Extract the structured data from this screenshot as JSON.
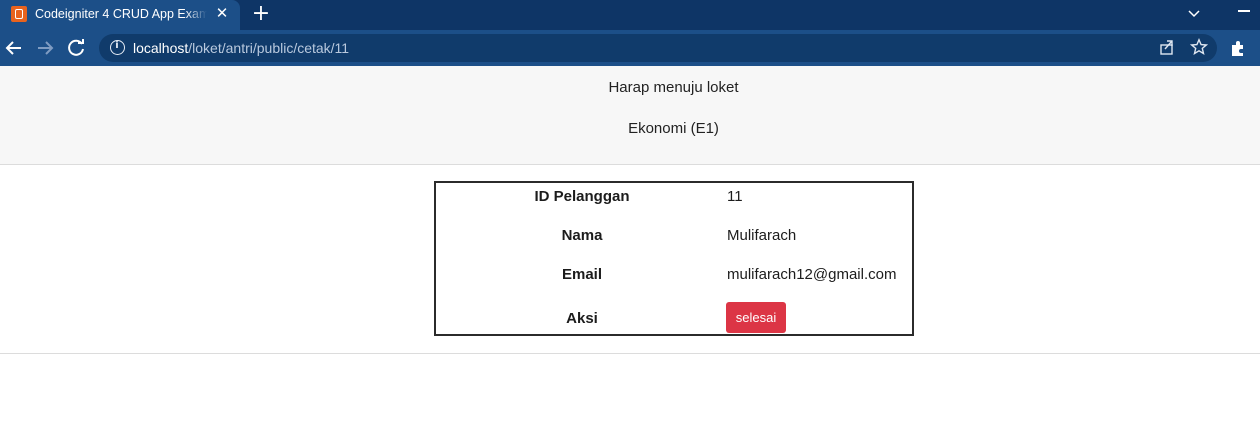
{
  "browser": {
    "tab_title": "Codeigniter 4 CRUD App Example",
    "tab_close": "✕",
    "new_tab": "+",
    "url_host": "localhost",
    "url_path": "/loket/antri/public/cetak/11",
    "icons": [
      "back-icon",
      "forward-icon",
      "reload-icon",
      "info-icon",
      "share-icon",
      "star-icon",
      "extensions-icon",
      "chevron-down-icon",
      "minimize-icon"
    ]
  },
  "header": {
    "line1": "Harap menuju loket",
    "line2": "Ekonomi (E1)"
  },
  "details": {
    "rows": [
      {
        "label": "ID Pelanggan",
        "value": "11"
      },
      {
        "label": "Nama",
        "value": "Mulifarach"
      },
      {
        "label": "Email",
        "value": "mulifarach12@gmail.com"
      },
      {
        "label": "Aksi",
        "value": ""
      }
    ],
    "action_button": "selesai"
  },
  "colors": {
    "tabbar": "#0e3566",
    "toolbar": "#1c4f88",
    "button_danger": "#dc3545",
    "header_bg": "#f7f7f7"
  }
}
